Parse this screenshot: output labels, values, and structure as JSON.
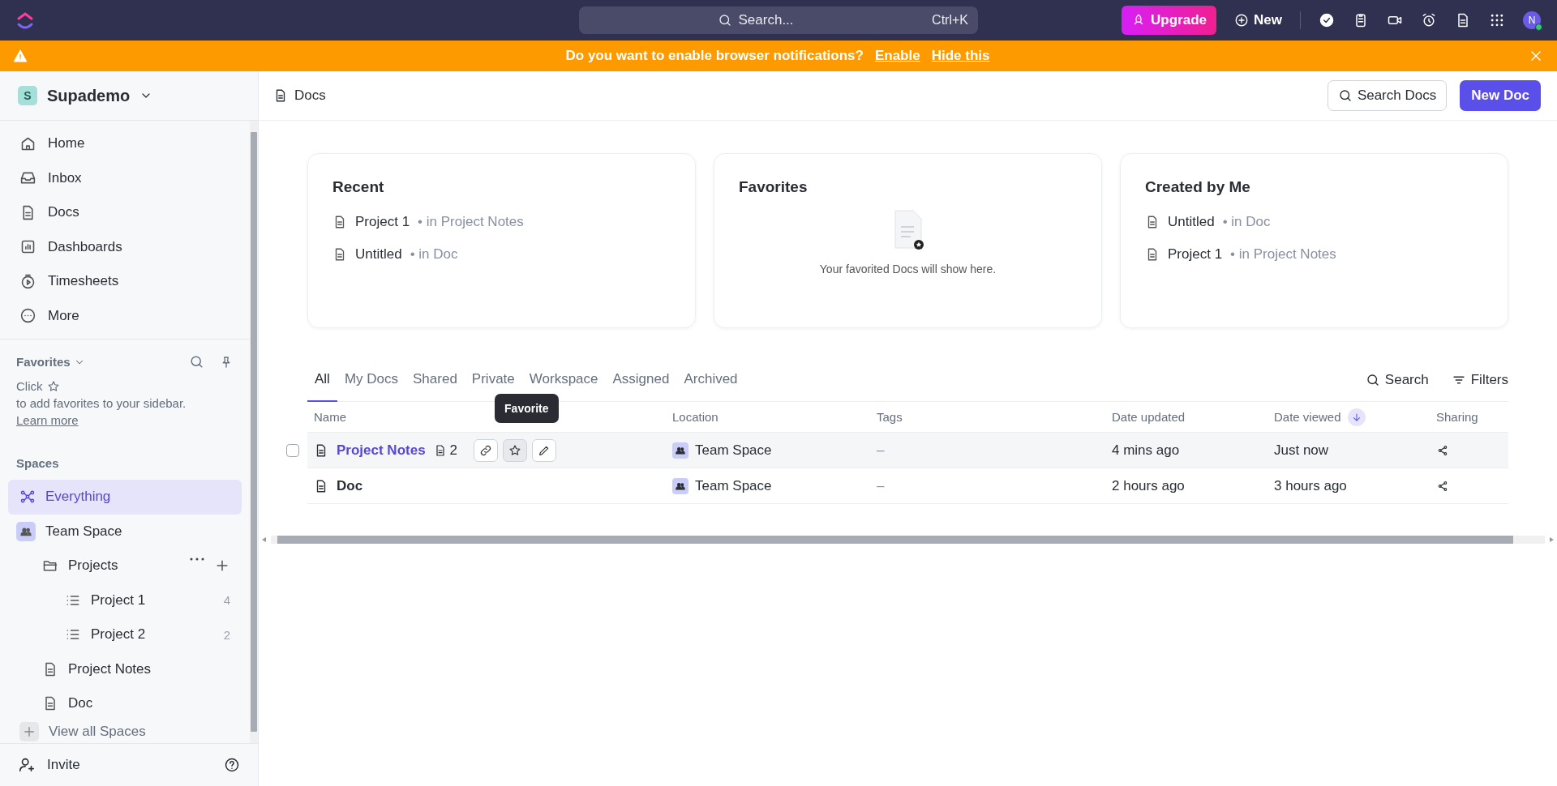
{
  "topbar": {
    "search_placeholder": "Search...",
    "shortcut": "Ctrl+K",
    "upgrade": "Upgrade",
    "new": "New",
    "avatar": "N"
  },
  "banner": {
    "message": "Do you want to enable browser notifications?",
    "enable": "Enable",
    "hide": "Hide this"
  },
  "sidebar": {
    "workspace": "Supademo",
    "workspace_initial": "S",
    "nav": [
      {
        "label": "Home"
      },
      {
        "label": "Inbox"
      },
      {
        "label": "Docs"
      },
      {
        "label": "Dashboards"
      },
      {
        "label": "Timesheets"
      },
      {
        "label": "More"
      }
    ],
    "favorites": {
      "title": "Favorites",
      "hint_before": "Click",
      "hint_after": "to add favorites to your sidebar.",
      "learn_more": "Learn more"
    },
    "spaces_title": "Spaces",
    "spaces": [
      {
        "label": "Everything",
        "kind": "everything",
        "selected": true
      },
      {
        "label": "Team Space",
        "kind": "space",
        "selected": false,
        "children": [
          {
            "label": "Projects",
            "kind": "folder",
            "selected": false,
            "children": [
              {
                "label": "Project 1",
                "kind": "list",
                "count": "4",
                "selected": false
              },
              {
                "label": "Project 2",
                "kind": "list",
                "count": "2",
                "selected": false
              }
            ]
          },
          {
            "label": "Project Notes",
            "kind": "doc",
            "selected": false
          },
          {
            "label": "Doc",
            "kind": "doc",
            "selected": false
          }
        ]
      }
    ],
    "view_all": "View all Spaces",
    "invite": "Invite"
  },
  "header": {
    "breadcrumb": "Docs",
    "search_button": "Search Docs",
    "new_button": "New Doc"
  },
  "cards": [
    {
      "title": "Recent",
      "items": [
        {
          "name": "Project 1",
          "location": "• in Project Notes"
        },
        {
          "name": "Untitled",
          "location": "• in Doc"
        }
      ]
    },
    {
      "title": "Favorites",
      "empty_text": "Your favorited Docs will show here."
    },
    {
      "title": "Created by Me",
      "items": [
        {
          "name": "Untitled",
          "location": "• in Doc"
        },
        {
          "name": "Project 1",
          "location": "• in Project Notes"
        }
      ]
    }
  ],
  "tabs": [
    {
      "label": "All",
      "selected": true
    },
    {
      "label": "My Docs",
      "selected": false
    },
    {
      "label": "Shared",
      "selected": false
    },
    {
      "label": "Private",
      "selected": false
    },
    {
      "label": "Workspace",
      "selected": false
    },
    {
      "label": "Assigned",
      "selected": false
    },
    {
      "label": "Archived",
      "selected": false
    }
  ],
  "table_tools": {
    "search": "Search",
    "filters": "Filters"
  },
  "table": {
    "columns": [
      "Name",
      "Location",
      "Tags",
      "Date updated",
      "Date viewed",
      "Sharing"
    ],
    "rows": [
      {
        "name": "Project Notes",
        "hovered": true,
        "page_count": "2",
        "tooltip": "Favorite",
        "location": "Team Space",
        "tags": "–",
        "date_updated": "4 mins ago",
        "date_viewed": "Just now"
      },
      {
        "name": "Doc",
        "hovered": false,
        "location": "Team Space",
        "tags": "–",
        "date_updated": "2 hours ago",
        "date_viewed": "3 hours ago"
      }
    ]
  }
}
